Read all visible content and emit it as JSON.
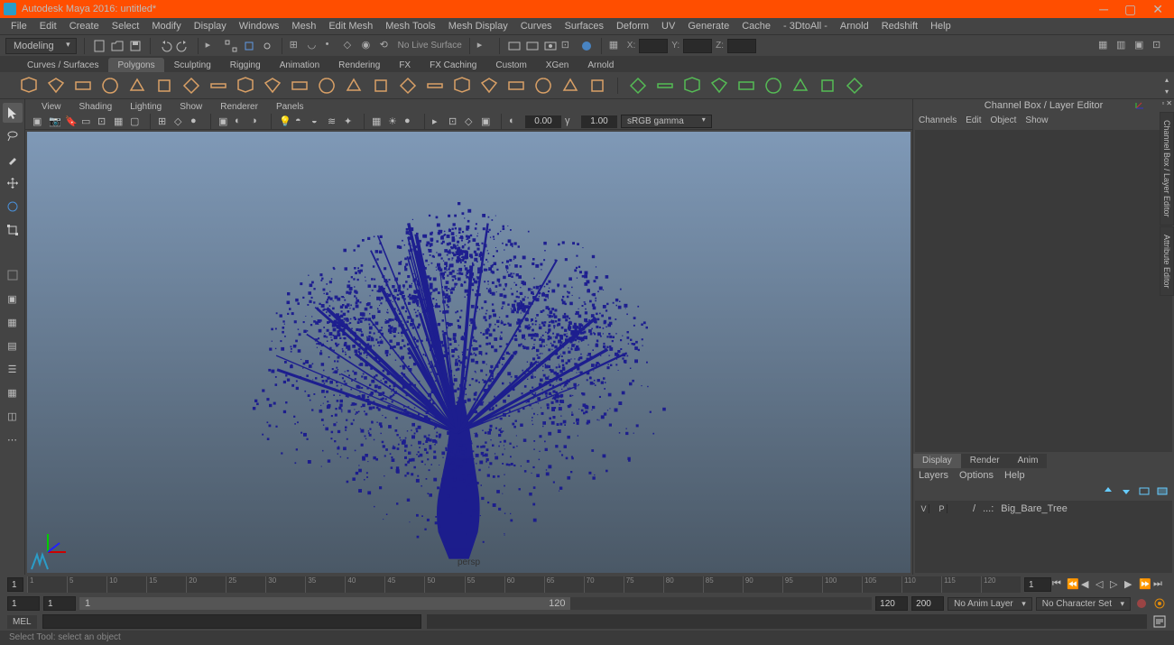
{
  "title": "Autodesk Maya 2016: untitled*",
  "menubar": [
    "File",
    "Edit",
    "Create",
    "Select",
    "Modify",
    "Display",
    "Windows",
    "Mesh",
    "Edit Mesh",
    "Mesh Tools",
    "Mesh Display",
    "Curves",
    "Surfaces",
    "Deform",
    "UV",
    "Generate",
    "Cache",
    "- 3DtoAll -",
    "Arnold",
    "Redshift",
    "Help"
  ],
  "workspace_dropdown": "Modeling",
  "live_surface": "No Live Surface",
  "coord_labels": {
    "x": "X:",
    "y": "Y:",
    "z": "Z:"
  },
  "shelf_tabs": [
    "Curves / Surfaces",
    "Polygons",
    "Sculpting",
    "Rigging",
    "Animation",
    "Rendering",
    "FX",
    "FX Caching",
    "Custom",
    "XGen",
    "Arnold"
  ],
  "shelf_active": 1,
  "viewport_menu": [
    "View",
    "Shading",
    "Lighting",
    "Show",
    "Renderer",
    "Panels"
  ],
  "vp_gamma": "sRGB gamma",
  "vp_exposure": "0.00",
  "vp_gamma_val": "1.00",
  "camera": "persp",
  "channelbox_title": "Channel Box / Layer Editor",
  "channel_tabs": [
    "Channels",
    "Edit",
    "Object",
    "Show"
  ],
  "side_tabs": [
    "Channel Box / Layer Editor",
    "Attribute Editor"
  ],
  "layer_tabs": [
    "Display",
    "Render",
    "Anim"
  ],
  "layer_submenu": [
    "Layers",
    "Options",
    "Help"
  ],
  "layer_item": {
    "v": "V",
    "p": "P",
    "slash": "/",
    "ellipsis": "...:",
    "name": "Big_Bare_Tree"
  },
  "timeline": {
    "start": 1,
    "ticks": [
      1,
      5,
      10,
      15,
      20,
      25,
      30,
      35,
      40,
      45,
      50,
      55,
      60,
      65,
      70,
      75,
      80,
      85,
      90,
      95,
      100,
      105,
      110,
      115,
      120
    ],
    "current": 1
  },
  "range": {
    "outer_start": "1",
    "inner_start": "1",
    "inner_end": "120",
    "outer_end": "200",
    "inner_handle_start": "1",
    "inner_handle_end": "120"
  },
  "anim_layer_dd": "No Anim Layer",
  "char_set_dd": "No Character Set",
  "cmd_label": "MEL",
  "helpline": "Select Tool: select an object"
}
